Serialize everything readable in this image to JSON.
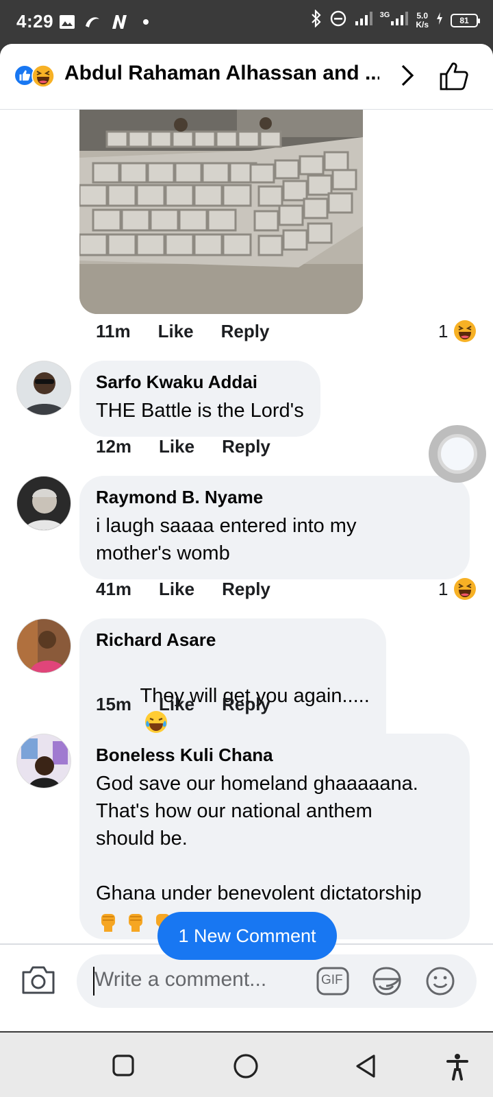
{
  "status_bar": {
    "time": "4:29",
    "network": "3G",
    "speed_value": "5.0",
    "speed_unit": "K/s",
    "battery": "81"
  },
  "header": {
    "title": "Abdul Rahaman Alhassan and ...",
    "reactions": [
      "like-icon",
      "haha-icon"
    ]
  },
  "first_comment_meta": {
    "time": "11m",
    "like": "Like",
    "reply": "Reply",
    "reaction_count": "1"
  },
  "comments": [
    {
      "author": "Sarfo Kwaku Addai",
      "text": "THE Battle is the Lord's",
      "time": "12m",
      "like": "Like",
      "reply": "Reply",
      "reaction_count": ""
    },
    {
      "author": "Raymond B. Nyame",
      "text": "i laugh saaaa entered into my\nmother's womb",
      "time": "41m",
      "like": "Like",
      "reply": "Reply",
      "reaction_count": "1"
    },
    {
      "author": "Richard Asare",
      "text": "They will get you again.....",
      "time": "15m",
      "like": "Like",
      "reply": "Reply",
      "reaction_count": ""
    },
    {
      "author": "Boneless Kuli Chana",
      "text": "God save our homeland ghaaaaana.\nThat's how our national anthem\nshould be.\n\nGhana under benevolent dictatorship",
      "time": "",
      "like": "",
      "reply": "",
      "reaction_count": ""
    }
  ],
  "new_comment_pill": "1 New Comment",
  "composer": {
    "placeholder": "Write a comment...",
    "gif_label": "GIF"
  },
  "colors": {
    "accent": "#1877f2",
    "bubble": "#f0f2f5",
    "status_bar": "#3a3a3a"
  }
}
